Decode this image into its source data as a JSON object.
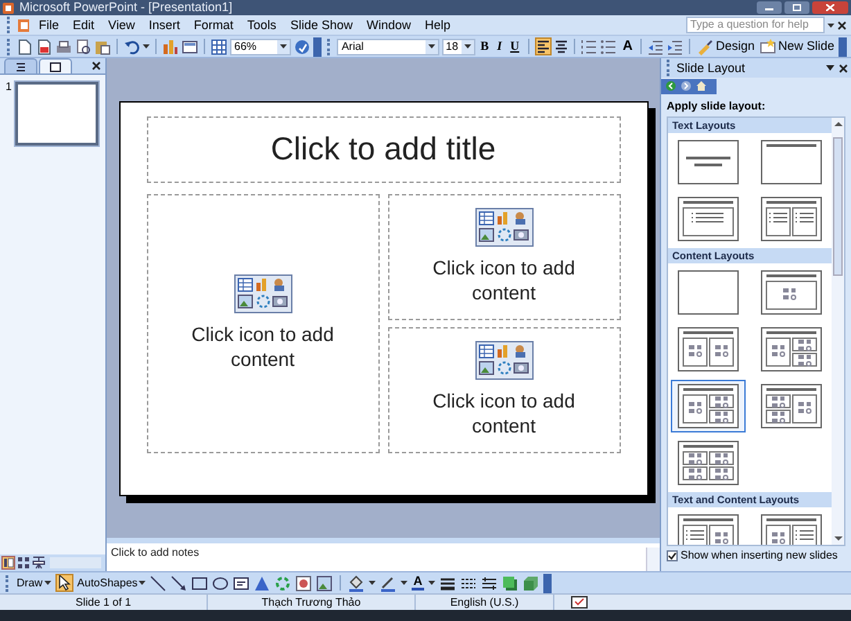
{
  "window": {
    "title": "Microsoft PowerPoint - [Presentation1]"
  },
  "menu": [
    "File",
    "Edit",
    "View",
    "Insert",
    "Format",
    "Tools",
    "Slide Show",
    "Window",
    "Help"
  ],
  "help": {
    "placeholder": "Type a question for help"
  },
  "toolbar": {
    "zoom": "66%",
    "font": "Arial",
    "font_size": "18",
    "bold": "B",
    "italic": "I",
    "underline": "U",
    "grow_font": "A",
    "design": "Design",
    "new_slide": "New Slide",
    "align": [
      {
        "kind": "left",
        "selected": true
      },
      {
        "kind": "center",
        "selected": false
      }
    ]
  },
  "slides_pane": {
    "tabs": [
      {
        "kind": "outline",
        "selected": false
      },
      {
        "kind": "slides",
        "selected": true
      }
    ],
    "slides": [
      {
        "number": "1",
        "selected": true
      }
    ]
  },
  "slide": {
    "title": "Click to add title",
    "placeholders": [
      {
        "text": "Click icon to add content"
      },
      {
        "text": "Click icon to add content"
      },
      {
        "text": "Click icon to add content"
      }
    ]
  },
  "notes": {
    "prompt": "Click to add notes"
  },
  "task_pane": {
    "title": "Slide Layout",
    "heading": "Apply slide layout:",
    "sections": [
      {
        "title": "Text Layouts",
        "layouts": [
          {
            "kind": "title-slide",
            "selected": false
          },
          {
            "kind": "title-only",
            "selected": false
          },
          {
            "kind": "title-text",
            "selected": false
          },
          {
            "kind": "two-text",
            "selected": false
          }
        ]
      },
      {
        "title": "Content Layouts",
        "layouts": [
          {
            "kind": "blank",
            "selected": false
          },
          {
            "kind": "content",
            "selected": false
          },
          {
            "kind": "two-content",
            "selected": false
          },
          {
            "kind": "two-content-half",
            "selected": false
          },
          {
            "kind": "content-two-stack",
            "selected": true
          },
          {
            "kind": "two-stack-content",
            "selected": false
          },
          {
            "kind": "four-content",
            "selected": false
          }
        ]
      },
      {
        "title": "Text and Content Layouts",
        "layouts": [
          {
            "kind": "text-content",
            "selected": false
          },
          {
            "kind": "content-text",
            "selected": false
          }
        ]
      }
    ],
    "show_on_insert": {
      "label": "Show when inserting new slides",
      "checked": true
    }
  },
  "drawing_toolbar": {
    "draw": "Draw",
    "autoshapes": "AutoShapes",
    "font_color": "A",
    "select_active": true
  },
  "status_bar": [
    "Slide 1 of 1",
    "Thạch Trương Thảo",
    "English (U.S.)"
  ]
}
